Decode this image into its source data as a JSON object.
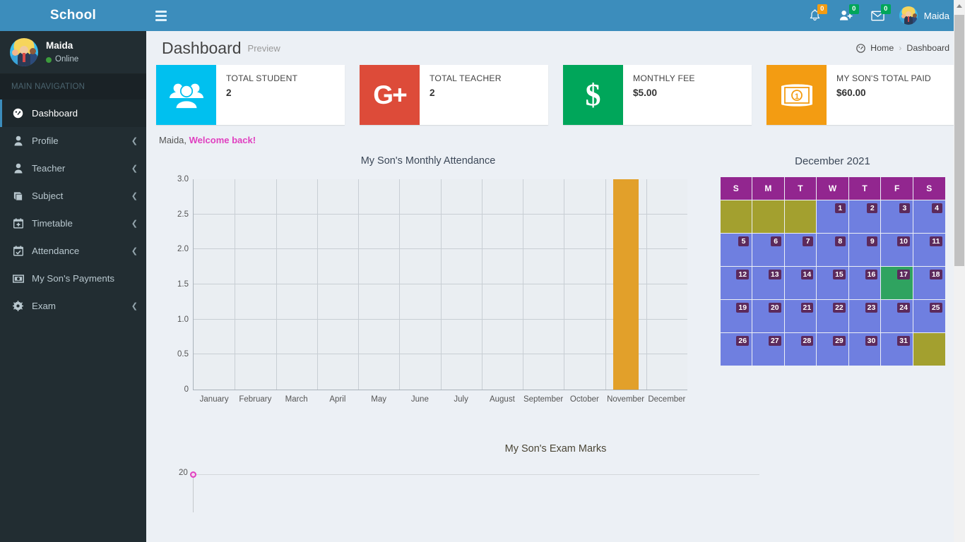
{
  "brand": {
    "title": "School"
  },
  "sidebar": {
    "user": {
      "name": "Maida",
      "status": "Online"
    },
    "nav_header": "MAIN NAVIGATION",
    "items": [
      {
        "label": "Dashboard",
        "icon": "dashboard-icon",
        "active": true,
        "caret": ""
      },
      {
        "label": "Profile",
        "icon": "user-icon",
        "active": false,
        "caret": "❮"
      },
      {
        "label": "Teacher",
        "icon": "user-icon",
        "active": false,
        "caret": "❮"
      },
      {
        "label": "Subject",
        "icon": "book-icon",
        "active": false,
        "caret": "❮"
      },
      {
        "label": "Timetable",
        "icon": "calendar-plus-icon",
        "active": false,
        "caret": "❮"
      },
      {
        "label": "Attendance",
        "icon": "calendar-check-icon",
        "active": false,
        "caret": "❮"
      },
      {
        "label": "My Son's Payments",
        "icon": "money-icon",
        "active": false,
        "caret": ""
      },
      {
        "label": "Exam",
        "icon": "gear-icon",
        "active": false,
        "caret": "❮"
      }
    ]
  },
  "topbar": {
    "notifications_badge": "0",
    "users_badge": "0",
    "messages_badge": "0",
    "user_name": "Maida"
  },
  "header": {
    "title": "Dashboard",
    "subtitle": "Preview",
    "breadcrumb_home": "Home",
    "breadcrumb_sep": "›",
    "breadcrumb_current": "Dashboard"
  },
  "cards": [
    {
      "label": "TOTAL STUDENT",
      "value": "2",
      "icon": "users-icon",
      "color": "#00c0ef"
    },
    {
      "label": "TOTAL TEACHER",
      "value": "2",
      "icon": "google-plus-icon",
      "color": "#dd4b39"
    },
    {
      "label": "MONTHLY FEE",
      "value": "$5.00",
      "icon": "dollar-icon",
      "color": "#00a65a"
    },
    {
      "label": "MY SON'S TOTAL PAID",
      "value": "$60.00",
      "icon": "money-bill-icon",
      "color": "#f39c12"
    }
  ],
  "welcome": {
    "prefix": "Maida, ",
    "highlight": "Welcome back!",
    "highlight_color": "#e040c0"
  },
  "calendar": {
    "title": "December 2021",
    "weekdays": [
      "S",
      "M",
      "T",
      "W",
      "T",
      "F",
      "S"
    ],
    "leading_blanks": 3,
    "days": [
      1,
      2,
      3,
      4,
      5,
      6,
      7,
      8,
      9,
      10,
      11,
      12,
      13,
      14,
      15,
      16,
      17,
      18,
      19,
      20,
      21,
      22,
      23,
      24,
      25,
      26,
      27,
      28,
      29,
      30,
      31
    ],
    "today": 17,
    "trailing_blanks": 1,
    "header_color": "#92268f",
    "cell_color": "#6f7fe0",
    "blank_color": "#a3a02f",
    "today_color": "#2fa360",
    "badge_color": "#5c2a5c"
  },
  "chart_data": [
    {
      "type": "bar",
      "title": "My Son's Monthly Attendance",
      "categories": [
        "January",
        "February",
        "March",
        "April",
        "May",
        "June",
        "July",
        "August",
        "September",
        "October",
        "November",
        "December"
      ],
      "values": [
        0,
        0,
        0,
        0,
        0,
        0,
        0,
        0,
        0,
        0,
        3,
        0
      ],
      "yticks": [
        "0",
        "0.5",
        "1.0",
        "1.5",
        "2.0",
        "2.5",
        "3.0"
      ],
      "ytick_values": [
        0,
        0.5,
        1.0,
        1.5,
        2.0,
        2.5,
        3.0
      ],
      "ylim": [
        0,
        3
      ],
      "xlabel": "",
      "ylabel": "",
      "grid": true,
      "legend": "none",
      "bar_color": "#e2a02a"
    },
    {
      "type": "line",
      "title": "My Son's Exam Marks",
      "categories": [],
      "values": [],
      "yticks": [
        "20"
      ],
      "ytick_values": [
        20
      ],
      "ylim": [
        0,
        20
      ],
      "xlabel": "",
      "ylabel": "",
      "grid": true,
      "legend": "none",
      "marker_color": "#e040c0"
    }
  ]
}
